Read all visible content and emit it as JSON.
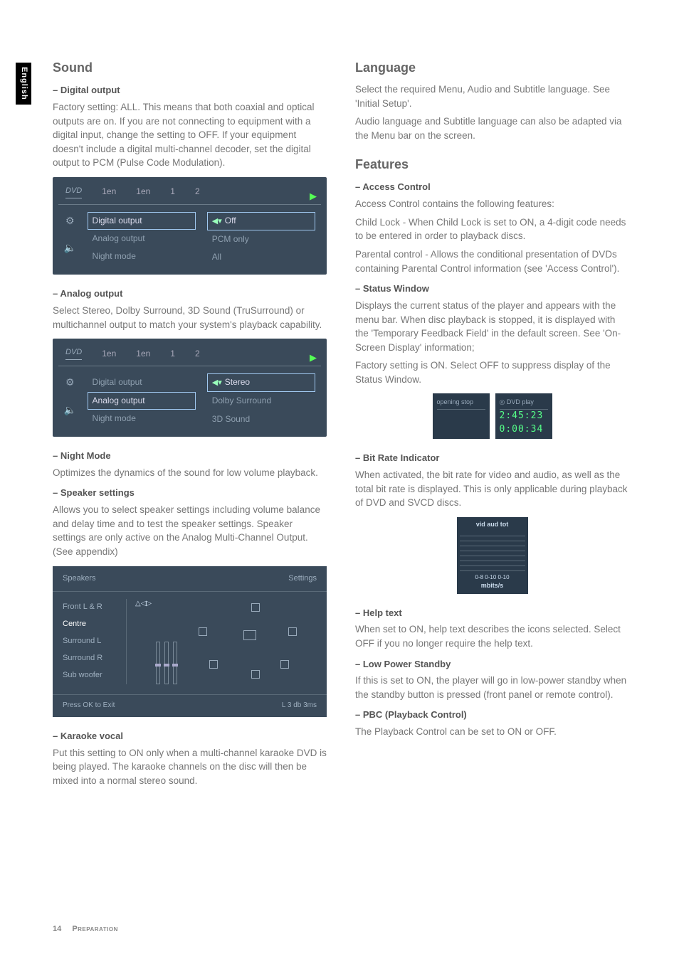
{
  "side_tab": "English",
  "footer": {
    "page": "14",
    "section": "Preparation"
  },
  "left": {
    "h_sound": "Sound",
    "digital_output": {
      "h": "–  Digital output",
      "p": "Factory setting: ALL. This means that both coaxial and optical outputs are on. If you are not connecting to equipment with a digital input, change the setting to OFF. If your equipment doesn't include a digital multi-channel decoder, set the digital output to PCM (Pulse Code Modulation)."
    },
    "ui1": {
      "top": {
        "dvd": "DVD",
        "t1": "1en",
        "t2": "1en",
        "t3": "1",
        "t4": "2"
      },
      "col1": [
        "Digital output",
        "Analog output",
        "Night mode"
      ],
      "col2": [
        "Off",
        "PCM only",
        "All"
      ]
    },
    "analog_output": {
      "h": "–  Analog output",
      "p": "Select Stereo, Dolby Surround, 3D Sound (TruSurround) or multichannel output to match your system's playback capability."
    },
    "ui2": {
      "top": {
        "dvd": "DVD",
        "t1": "1en",
        "t2": "1en",
        "t3": "1",
        "t4": "2"
      },
      "col1": [
        "Digital output",
        "Analog output",
        "Night mode"
      ],
      "col2": [
        "Stereo",
        "Dolby Surround",
        "3D Sound"
      ]
    },
    "night_mode": {
      "h": "–  Night Mode",
      "p": "Optimizes the dynamics of the sound for low volume playback."
    },
    "speaker_settings": {
      "h": "–  Speaker settings",
      "p": "Allows you to select speaker settings including volume balance and delay time and to test the speaker settings. Speaker settings are only active on the Analog Multi-Channel Output. (See appendix)"
    },
    "speaker_ui": {
      "title": "Speakers",
      "right": "Settings",
      "list": [
        "Front L & R",
        "Centre",
        "Surround L",
        "Surround R",
        "Sub woofer"
      ],
      "bottom_left": "Press OK to Exit",
      "bottom_right": "L   3 db 3ms"
    },
    "karaoke": {
      "h": "–  Karaoke vocal",
      "p": "Put this setting to ON only when a multi-channel karaoke DVD is being played. The karaoke channels on the disc will then be mixed into a normal stereo sound."
    }
  },
  "right": {
    "h_language": "Language",
    "language_p1": "Select the required Menu, Audio and Subtitle language. See 'Initial Setup'.",
    "language_p2": "Audio language and Subtitle language can also be adapted via the Menu bar on the screen.",
    "h_features": "Features",
    "access": {
      "h": "–  Access Control",
      "p1": "Access Control contains the following features:",
      "p2": "Child Lock - When Child Lock is set to ON, a 4-digit code needs to be entered in order to playback discs.",
      "p3": "Parental control - Allows the conditional presentation of DVDs containing Parental Control information (see 'Access Control')."
    },
    "status": {
      "h": "–  Status Window",
      "p1": "Displays the current status of the player and appears with the menu bar.  When disc playback is stopped, it is displayed with the 'Temporary Feedback Field' in the default screen. See 'On-Screen Display' information;",
      "p2": "Factory setting is ON. Select OFF to suppress display of the Status Window."
    },
    "status_ui": {
      "left_top": "opening   stop",
      "right_top": "DVD   play",
      "time1": "2:45:23",
      "time2": "0:00:34"
    },
    "bitrate": {
      "h": "–  Bit Rate Indicator",
      "p": "When activated, the bit rate for video and audio, as well as the total bit rate is displayed. This is only applicable during playback of DVD and SVCD discs."
    },
    "bitrate_ui": {
      "hdr": "vid  aud  tot",
      "scale": "0-8   0-10   0-10",
      "unit": "mbits/s"
    },
    "help": {
      "h": "–  Help text",
      "p": "When set to ON, help text describes the icons selected. Select OFF if you no longer require the help text."
    },
    "lowpower": {
      "h": "–  Low Power Standby",
      "p": "If this is set to ON, the player will go in low-power standby when the standby button is pressed (front panel or remote control)."
    },
    "pbc": {
      "h": "–  PBC (Playback Control)",
      "p": "The Playback Control can be set to ON or OFF."
    }
  }
}
